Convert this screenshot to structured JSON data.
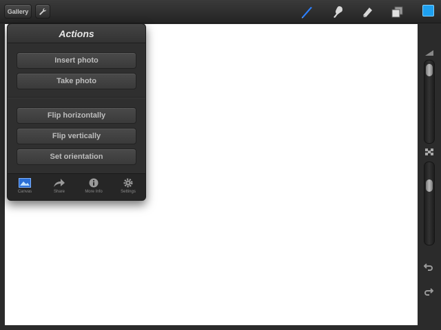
{
  "toolbar": {
    "gallery_label": "Gallery",
    "tools": [
      {
        "name": "brush",
        "icon": "brush-icon",
        "active": true
      },
      {
        "name": "smudge",
        "icon": "smudge-icon",
        "active": false
      },
      {
        "name": "eraser",
        "icon": "eraser-icon",
        "active": false
      },
      {
        "name": "layers",
        "icon": "layers-icon",
        "active": false
      }
    ],
    "current_color": "#1ea0f0"
  },
  "actions_popover": {
    "title": "Actions",
    "group1": [
      "Insert photo",
      "Take photo"
    ],
    "group2": [
      "Flip horizontally",
      "Flip vertically",
      "Set orientation"
    ],
    "tabs": [
      {
        "label": "Canvas",
        "icon": "canvas-icon",
        "active": true
      },
      {
        "label": "Share",
        "icon": "share-icon",
        "active": false
      },
      {
        "label": "More Info",
        "icon": "info-icon",
        "active": false
      },
      {
        "label": "Settings",
        "icon": "gear-icon",
        "active": false
      }
    ]
  },
  "sidebar": {
    "brush_size_level": 0.05,
    "opacity_level": 0.25
  },
  "colors": {
    "accent": "#1ea0f0",
    "active_tool": "#2b7fff"
  }
}
